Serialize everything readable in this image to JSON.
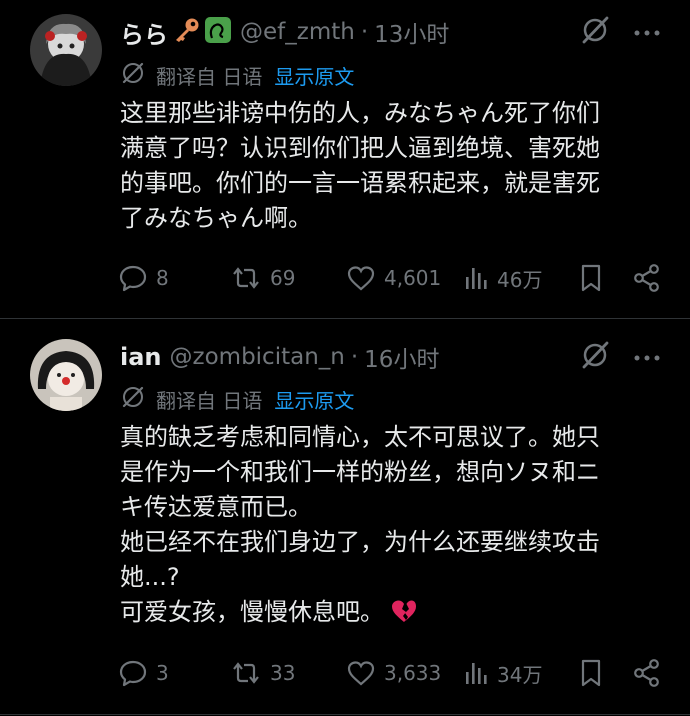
{
  "tweets": [
    {
      "display_name": "らら",
      "handle": "@ef_zmth",
      "separator": "·",
      "time": "13小时",
      "translated_label": "翻译自 日语",
      "show_original": "显示原文",
      "lines": [
        "这里那些诽谤中伤的人，みなちゃん死了你们",
        "满意了吗？认识到你们把人逼到绝境、害死她",
        "的事吧。你们的一言一语累积起来，就是害死",
        "了みなちゃん啊。"
      ],
      "replies": "8",
      "reposts": "69",
      "likes": "4,601",
      "views": "46万"
    },
    {
      "display_name": "ian",
      "handle": "@zombicitan_n",
      "separator": "·",
      "time": "16小时",
      "translated_label": "翻译自 日语",
      "show_original": "显示原文",
      "lines": [
        "真的缺乏考虑和同情心，太不可思议了。她只",
        "是作为一个和我们一样的粉丝，想向ソヌ和ニ",
        "キ传达爱意而已。",
        "她已经不在我们身边了，为什么还要继续攻击",
        "她...?",
        "可爱女孩，慢慢休息吧。"
      ],
      "replies": "3",
      "reposts": "33",
      "likes": "3,633",
      "views": "34万"
    }
  ],
  "colors": {
    "background": "#000000",
    "text": "#e7e9ea",
    "muted": "#71767b",
    "link": "#1d9bf0",
    "divider": "#2f3336"
  },
  "icons": {
    "header_emojis": [
      "key-emoji",
      "snake-emoji"
    ],
    "line_end_emoji": "broken-heart-emoji",
    "actions": [
      "reply-icon",
      "repost-icon",
      "like-icon",
      "views-icon",
      "bookmark-icon",
      "share-icon"
    ]
  }
}
